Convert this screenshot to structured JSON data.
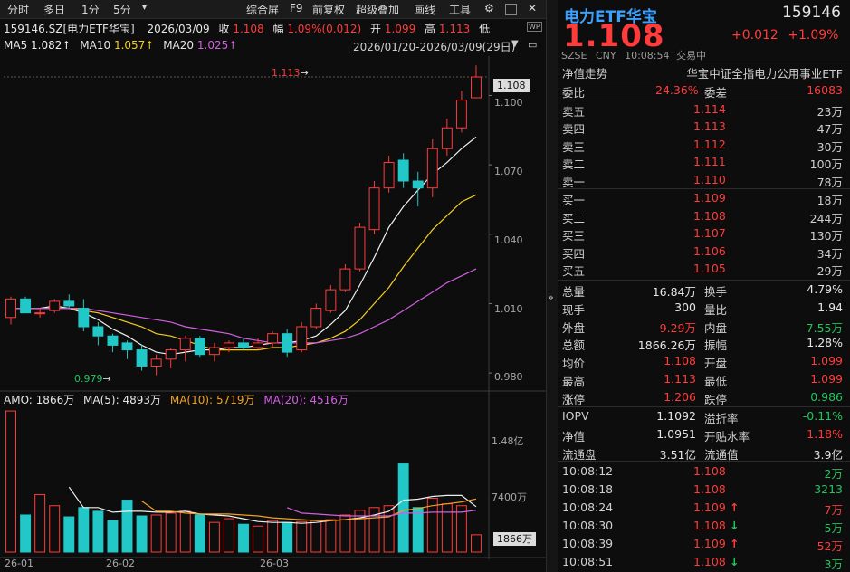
{
  "toolbar": {
    "left": [
      "分时",
      "多日",
      "1分",
      "5分"
    ],
    "right": [
      "综合屏",
      "F9",
      "前复权",
      "超级叠加",
      "画线",
      "工具"
    ]
  },
  "info": {
    "code_name": "159146.SZ[电力ETF华宝]",
    "date": "2026/03/09",
    "close_label": "收",
    "close": "1.108",
    "chg_label": "幅",
    "chg": "1.09%(0.012)",
    "open_label": "开",
    "open": "1.099",
    "high_label": "高",
    "high": "1.113",
    "low_label": "低",
    "ma5_label": "MA5",
    "ma5": "1.082↑",
    "ma10_label": "MA10",
    "ma10": "1.057↑",
    "ma20_label": "MA20",
    "ma20": "1.025↑",
    "range": "2026/01/20-2026/03/09(29日)"
  },
  "amo": {
    "amo_label": "AMO:",
    "amo": "1866万",
    "ma5_label": "MA(5):",
    "ma5": "4893万",
    "ma10_label": "MA(10):",
    "ma10": "5719万",
    "ma20_label": "MA(20):",
    "ma20": "4516万"
  },
  "price_axis": {
    "ticks": [
      "1.100",
      "1.070",
      "1.040",
      "1.010",
      "0.980"
    ],
    "current": "1.108",
    "high_mark": "1.113",
    "low_mark": "0.979"
  },
  "vol_axis": {
    "ticks": [
      "1.48亿",
      "7400万"
    ],
    "current": "1866万"
  },
  "date_axis": [
    "26-01",
    "26-02",
    "26-03"
  ],
  "colors": {
    "up": "#ff3b3b",
    "down": "#22c7c7",
    "ma5": "#f0f0f0",
    "ma10": "#f5d020",
    "ma20": "#d060e0",
    "vma10": "#f0a020"
  },
  "chart_data": {
    "type": "candlestick",
    "candles": [
      {
        "o": 1.004,
        "h": 1.013,
        "l": 1.001,
        "c": 1.012
      },
      {
        "o": 1.012,
        "h": 1.013,
        "l": 1.006,
        "c": 1.006
      },
      {
        "o": 1.006,
        "h": 1.008,
        "l": 1.004,
        "c": 1.006
      },
      {
        "o": 1.007,
        "h": 1.012,
        "l": 1.006,
        "c": 1.011
      },
      {
        "o": 1.011,
        "h": 1.014,
        "l": 1.008,
        "c": 1.009
      },
      {
        "o": 1.008,
        "h": 1.012,
        "l": 0.998,
        "c": 1.0
      },
      {
        "o": 1.0,
        "h": 1.002,
        "l": 0.992,
        "c": 0.996
      },
      {
        "o": 0.996,
        "h": 0.997,
        "l": 0.989,
        "c": 0.992
      },
      {
        "o": 0.993,
        "h": 0.994,
        "l": 0.986,
        "c": 0.99
      },
      {
        "o": 0.99,
        "h": 0.992,
        "l": 0.981,
        "c": 0.983
      },
      {
        "o": 0.983,
        "h": 0.988,
        "l": 0.979,
        "c": 0.986
      },
      {
        "o": 0.986,
        "h": 0.991,
        "l": 0.982,
        "c": 0.99
      },
      {
        "o": 0.99,
        "h": 0.996,
        "l": 0.985,
        "c": 0.995
      },
      {
        "o": 0.995,
        "h": 0.996,
        "l": 0.987,
        "c": 0.988
      },
      {
        "o": 0.988,
        "h": 0.993,
        "l": 0.985,
        "c": 0.991
      },
      {
        "o": 0.991,
        "h": 0.994,
        "l": 0.989,
        "c": 0.993
      },
      {
        "o": 0.993,
        "h": 0.995,
        "l": 0.99,
        "c": 0.991
      },
      {
        "o": 0.991,
        "h": 0.995,
        "l": 0.99,
        "c": 0.993
      },
      {
        "o": 0.993,
        "h": 0.998,
        "l": 0.991,
        "c": 0.997
      },
      {
        "o": 0.997,
        "h": 0.999,
        "l": 0.987,
        "c": 0.989
      },
      {
        "o": 0.99,
        "h": 1.002,
        "l": 0.989,
        "c": 1.0
      },
      {
        "o": 1.0,
        "h": 1.01,
        "l": 0.999,
        "c": 1.008
      },
      {
        "o": 1.007,
        "h": 1.018,
        "l": 1.006,
        "c": 1.016
      },
      {
        "o": 1.016,
        "h": 1.027,
        "l": 1.015,
        "c": 1.025
      },
      {
        "o": 1.025,
        "h": 1.045,
        "l": 1.024,
        "c": 1.043
      },
      {
        "o": 1.042,
        "h": 1.063,
        "l": 1.04,
        "c": 1.06
      },
      {
        "o": 1.06,
        "h": 1.074,
        "l": 1.058,
        "c": 1.071
      },
      {
        "o": 1.072,
        "h": 1.075,
        "l": 1.06,
        "c": 1.063
      },
      {
        "o": 1.063,
        "h": 1.067,
        "l": 1.052,
        "c": 1.06
      },
      {
        "o": 1.06,
        "h": 1.081,
        "l": 1.056,
        "c": 1.077
      },
      {
        "o": 1.077,
        "h": 1.09,
        "l": 1.074,
        "c": 1.086
      },
      {
        "o": 1.086,
        "h": 1.102,
        "l": 1.084,
        "c": 1.098
      },
      {
        "o": 1.099,
        "h": 1.113,
        "l": 1.099,
        "c": 1.108
      }
    ],
    "ma5": [
      1.008,
      1.008,
      1.008,
      1.009,
      1.008,
      1.006,
      1.003,
      0.999,
      0.996,
      0.992,
      0.989,
      0.988,
      0.989,
      0.99,
      0.99,
      0.991,
      0.991,
      0.992,
      0.993,
      0.993,
      0.994,
      0.996,
      1.001,
      1.007,
      1.018,
      1.03,
      1.043,
      1.052,
      1.059,
      1.066,
      1.071,
      1.077,
      1.082
    ],
    "ma10": [
      1.008,
      1.008,
      1.008,
      1.008,
      1.008,
      1.007,
      1.006,
      1.004,
      1.002,
      1.0,
      0.997,
      0.996,
      0.994,
      0.992,
      0.99,
      0.99,
      0.99,
      0.99,
      0.991,
      0.991,
      0.992,
      0.993,
      0.995,
      0.998,
      1.003,
      1.01,
      1.017,
      1.026,
      1.034,
      1.042,
      1.048,
      1.054,
      1.057
    ],
    "ma20": [
      1.008,
      1.008,
      1.008,
      1.008,
      1.008,
      1.008,
      1.007,
      1.006,
      1.005,
      1.004,
      1.003,
      1.002,
      1.0,
      0.999,
      0.998,
      0.997,
      0.995,
      0.994,
      0.993,
      0.993,
      0.993,
      0.993,
      0.994,
      0.995,
      0.997,
      1.0,
      1.003,
      1.007,
      1.011,
      1.015,
      1.019,
      1.022,
      1.025
    ],
    "volume": [
      152000000.0,
      40000000.0,
      62000000.0,
      50000000.0,
      38000000.0,
      48000000.0,
      44000000.0,
      34000000.0,
      56000000.0,
      39000000.0,
      40000000.0,
      42000000.0,
      44000000.0,
      40000000.0,
      32000000.0,
      36000000.0,
      30000000.0,
      28000000.0,
      34000000.0,
      32000000.0,
      33000000.0,
      34000000.0,
      35000000.0,
      40000000.0,
      45000000.0,
      48000000.0,
      50000000.0,
      95000000.0,
      48000000.0,
      58000000.0,
      52000000.0,
      50000000.0,
      18660000.0
    ],
    "vol_ma5": [
      null,
      null,
      null,
      null,
      70000000.0,
      48000000.0,
      48000000.0,
      43000000.0,
      44000000.0,
      44000000.0,
      43000000.0,
      43000000.0,
      44000000.0,
      41000000.0,
      40000000.0,
      39000000.0,
      36000000.0,
      33000000.0,
      32000000.0,
      32000000.0,
      31000000.0,
      32000000.0,
      34000000.0,
      35000000.0,
      37000000.0,
      40000000.0,
      44000000.0,
      56000000.0,
      57000000.0,
      60000000.0,
      61000000.0,
      61000000.0,
      48930000.0
    ],
    "vol_ma10": [
      null,
      null,
      null,
      null,
      null,
      null,
      null,
      null,
      null,
      55000000.0,
      44000000.0,
      44000000.0,
      42000000.0,
      41000000.0,
      41000000.0,
      41000000.0,
      40000000.0,
      39000000.0,
      37000000.0,
      36000000.0,
      35000000.0,
      34000000.0,
      34000000.0,
      35000000.0,
      36000000.0,
      37000000.0,
      38000000.0,
      45000000.0,
      47000000.0,
      50000000.0,
      52000000.0,
      54000000.0,
      57190000.0
    ],
    "vol_ma20": [
      null,
      null,
      null,
      null,
      null,
      null,
      null,
      null,
      null,
      null,
      null,
      null,
      null,
      null,
      null,
      null,
      null,
      null,
      null,
      48000000.0,
      42000000.0,
      41000000.0,
      40000000.0,
      39000000.0,
      39000000.0,
      39000000.0,
      39000000.0,
      42000000.0,
      42000000.0,
      43000000.0,
      43000000.0,
      43000000.0,
      45160000.0
    ],
    "price_range": [
      0.973,
      1.117
    ],
    "vol_max": 156000000.0
  },
  "panel": {
    "title": "电力ETF华宝",
    "code": "159146",
    "price": "1.108",
    "change": "+0.012",
    "change_pct": "+1.09%",
    "meta": [
      "SZSE",
      "CNY",
      "10:08:54",
      "交易中"
    ],
    "net_trend": "净值走势",
    "fund_full": "华宝中证全指电力公用事业ETF",
    "weibi_label": "委比",
    "weibi": "24.36%",
    "weicha_label": "委差",
    "weicha": "16083",
    "asks": [
      {
        "label": "卖五",
        "price": "1.114",
        "vol": "23万"
      },
      {
        "label": "卖四",
        "price": "1.113",
        "vol": "47万"
      },
      {
        "label": "卖三",
        "price": "1.112",
        "vol": "30万"
      },
      {
        "label": "卖二",
        "price": "1.111",
        "vol": "100万"
      },
      {
        "label": "卖一",
        "price": "1.110",
        "vol": "78万"
      }
    ],
    "bids": [
      {
        "label": "买一",
        "price": "1.109",
        "vol": "18万"
      },
      {
        "label": "买二",
        "price": "1.108",
        "vol": "244万"
      },
      {
        "label": "买三",
        "price": "1.107",
        "vol": "130万"
      },
      {
        "label": "买四",
        "price": "1.106",
        "vol": "34万"
      },
      {
        "label": "买五",
        "price": "1.105",
        "vol": "29万"
      }
    ],
    "stats": [
      {
        "l1": "总量",
        "v1": "16.84万",
        "c1": "white",
        "l2": "换手",
        "v2": "4.79%",
        "c2": "white"
      },
      {
        "l1": "现手",
        "v1": "300",
        "c1": "white",
        "l2": "量比",
        "v2": "1.94",
        "c2": "white"
      },
      {
        "l1": "外盘",
        "v1": "9.29万",
        "c1": "red",
        "l2": "内盘",
        "v2": "7.55万",
        "c2": "green"
      },
      {
        "l1": "总额",
        "v1": "1866.26万",
        "c1": "white",
        "l2": "振幅",
        "v2": "1.28%",
        "c2": "white"
      },
      {
        "l1": "均价",
        "v1": "1.108",
        "c1": "red",
        "l2": "开盘",
        "v2": "1.099",
        "c2": "red"
      },
      {
        "l1": "最高",
        "v1": "1.113",
        "c1": "red",
        "l2": "最低",
        "v2": "1.099",
        "c2": "red"
      },
      {
        "l1": "涨停",
        "v1": "1.206",
        "c1": "red",
        "l2": "跌停",
        "v2": "0.986",
        "c2": "green"
      }
    ],
    "stats2": [
      {
        "l1": "IOPV",
        "v1": "1.1092",
        "c1": "white",
        "l2": "溢折率",
        "v2": "-0.11%",
        "c2": "green"
      },
      {
        "l1": "净值",
        "v1": "1.0951",
        "c1": "white",
        "l2": "开贴水率",
        "v2": "1.18%",
        "c2": "red"
      },
      {
        "l1": "流通盘",
        "v1": "3.51亿",
        "c1": "white",
        "l2": "流通值",
        "v2": "3.9亿",
        "c2": "white"
      }
    ],
    "ticks": [
      {
        "time": "10:08:12",
        "price": "1.108",
        "arrow": "",
        "vol": "2万",
        "vc": "green"
      },
      {
        "time": "10:08:18",
        "price": "1.108",
        "arrow": "",
        "vol": "3213",
        "vc": "green"
      },
      {
        "time": "10:08:24",
        "price": "1.109",
        "arrow": "↑",
        "vol": "7万",
        "vc": "red"
      },
      {
        "time": "10:08:30",
        "price": "1.108",
        "arrow": "↓",
        "vol": "5万",
        "vc": "green"
      },
      {
        "time": "10:08:39",
        "price": "1.109",
        "arrow": "↑",
        "vol": "52万",
        "vc": "red"
      },
      {
        "time": "10:08:51",
        "price": "1.108",
        "arrow": "↓",
        "vol": "3万",
        "vc": "green"
      }
    ]
  }
}
